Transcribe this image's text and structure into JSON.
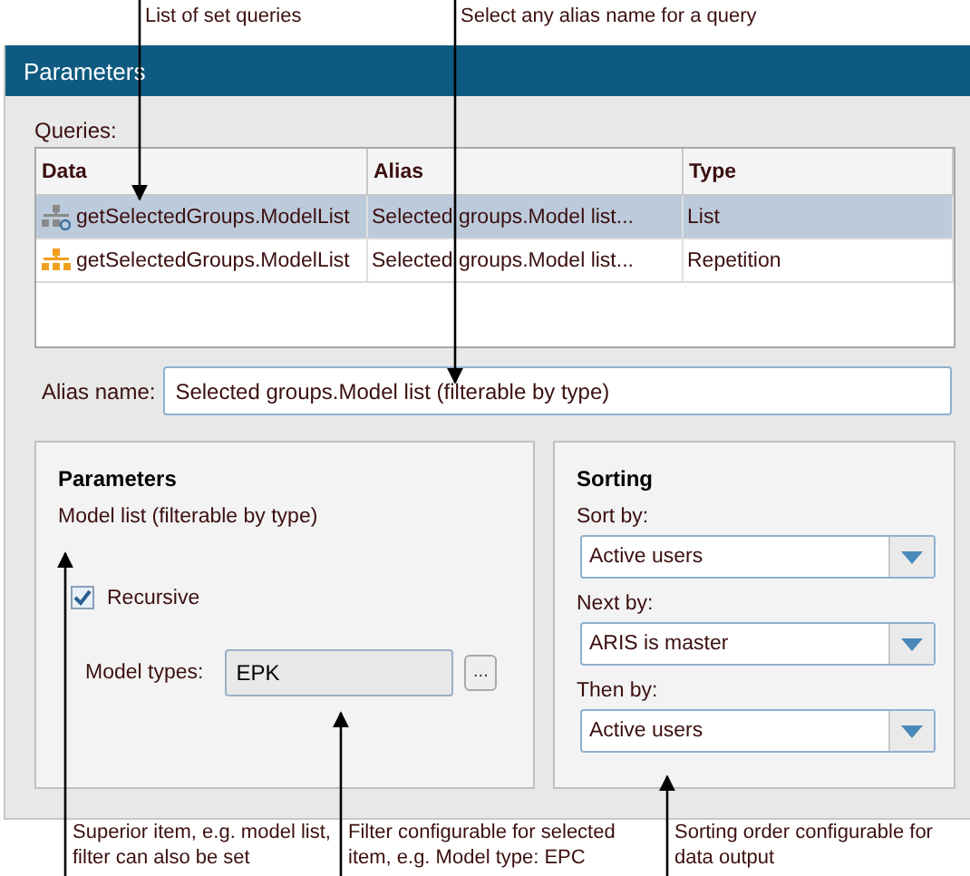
{
  "annotations_top": [
    {
      "text": "List of set queries"
    },
    {
      "text": "Select any alias name for a query"
    }
  ],
  "window": {
    "title": "Parameters"
  },
  "queries": {
    "label": "Queries:",
    "columns": [
      "Data",
      "Alias",
      "Type"
    ],
    "rows": [
      {
        "kind": "list",
        "data": "getSelectedGroups.ModelList",
        "alias": "Selected groups.Model list...",
        "type": "List",
        "selected": true
      },
      {
        "kind": "repetition",
        "data": "getSelectedGroups.ModelList",
        "alias": "Selected groups.Model list...",
        "type": "Repetition",
        "selected": false
      }
    ]
  },
  "alias": {
    "label": "Alias name:",
    "value": "Selected groups.Model list (filterable by type)"
  },
  "parameters": {
    "title": "Parameters",
    "item": "Model list (filterable by type)",
    "recursive": {
      "label": "Recursive",
      "checked": true
    },
    "model_types": {
      "label": "Model types:",
      "value": "EPK",
      "button": "..."
    }
  },
  "sorting": {
    "title": "Sorting",
    "fields": [
      {
        "label": "Sort by:",
        "value": "Active users"
      },
      {
        "label": "Next by:",
        "value": "ARIS is master"
      },
      {
        "label": "Then by:",
        "value": "Active users"
      }
    ]
  },
  "annotations_bottom": [
    {
      "text": "Superior item, e.g. model list, filter can also be set"
    },
    {
      "text": "Filter configurable for selected item, e.g. Model type: EPC"
    },
    {
      "text": "Sorting order configurable for data output"
    }
  ]
}
